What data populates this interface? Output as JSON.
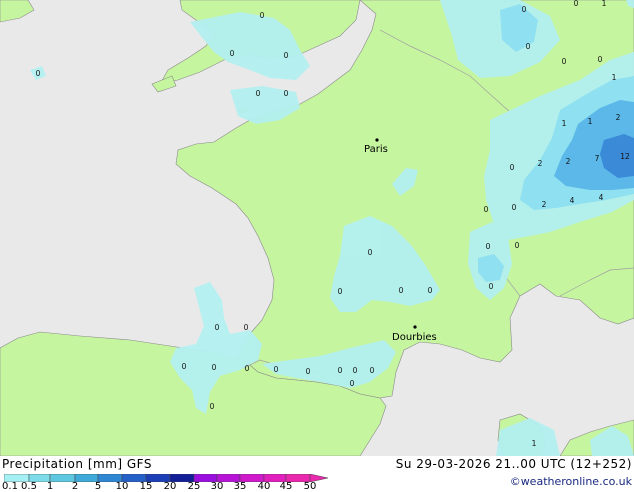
{
  "header": {
    "product": "Precipitation [mm]  GFS",
    "valid_time": "Su 29-03-2026 21..00 UTC (12+252)",
    "credit": "©weatheronline.co.uk"
  },
  "cities": [
    {
      "name": "Paris"
    },
    {
      "name": "Dourbies"
    }
  ],
  "value_labels": [
    "0",
    "0",
    "0",
    "0",
    "0",
    "0",
    "0",
    "0",
    "0",
    "1",
    "0",
    "0",
    "1",
    "1",
    "2",
    "1",
    "2",
    "7",
    "12",
    "0",
    "2",
    "2",
    "4",
    "4",
    "0",
    "0",
    "0",
    "0",
    "0",
    "0",
    "0",
    "0",
    "0",
    "0",
    "0",
    "0",
    "0",
    "0",
    "0",
    "0",
    "0",
    "0",
    "0",
    "0",
    "0",
    "1"
  ],
  "legend": {
    "ticks": [
      "0.1",
      "0.5",
      "1",
      "2",
      "5",
      "10",
      "15",
      "20",
      "25",
      "30",
      "35",
      "40",
      "45",
      "50"
    ],
    "colors": [
      "#a6f0f5",
      "#7ddcea",
      "#5ec8e0",
      "#3fa9d9",
      "#2f86d3",
      "#2560c8",
      "#1c3eb6",
      "#121f96",
      "#9a0fe0",
      "#b714d8",
      "#cf19cb",
      "#e01fbd",
      "#ea28ad"
    ]
  },
  "colors": {
    "sea": "#e9e9e9",
    "land": "#c6f5a0",
    "precip_light": "#b4f0f0",
    "precip_mid": "#8fe0f0",
    "precip_heavy": "#5bb8e8",
    "precip_max": "#3a8ad8",
    "borders": "#a0a0a0"
  }
}
